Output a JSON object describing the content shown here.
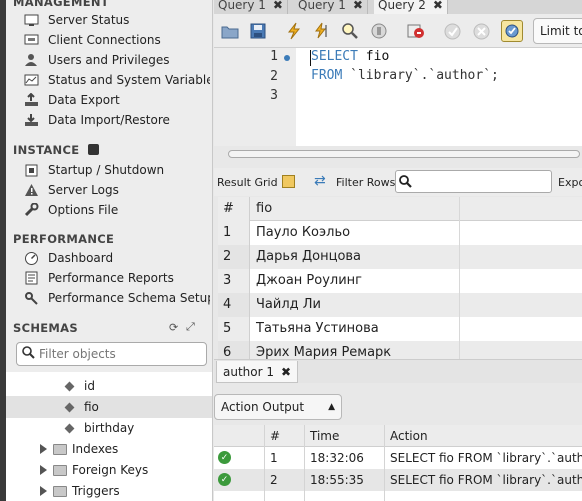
{
  "sidebar": {
    "management_title": "MANAGEMENT",
    "management_items": [
      {
        "label": "Server Status",
        "icon": "monitor-icon"
      },
      {
        "label": "Client Connections",
        "icon": "connection-icon"
      },
      {
        "label": "Users and Privileges",
        "icon": "users-icon"
      },
      {
        "label": "Status and System Variables",
        "icon": "variables-icon"
      },
      {
        "label": "Data Export",
        "icon": "export-icon"
      },
      {
        "label": "Data Import/Restore",
        "icon": "import-icon"
      }
    ],
    "instance_title": "INSTANCE",
    "instance_items": [
      {
        "label": "Startup / Shutdown",
        "icon": "power-icon"
      },
      {
        "label": "Server Logs",
        "icon": "warning-icon"
      },
      {
        "label": "Options File",
        "icon": "wrench-icon"
      }
    ],
    "performance_title": "PERFORMANCE",
    "performance_items": [
      {
        "label": "Dashboard",
        "icon": "dashboard-icon"
      },
      {
        "label": "Performance Reports",
        "icon": "reports-icon"
      },
      {
        "label": "Performance Schema Setup",
        "icon": "schema-setup-icon"
      }
    ],
    "schemas_title": "SCHEMAS",
    "schema_filter_placeholder": "Filter objects",
    "tree": {
      "columns": [
        "id",
        "fio",
        "birthday"
      ],
      "selected_column": "fio",
      "folders": [
        "Indexes",
        "Foreign Keys",
        "Triggers"
      ]
    }
  },
  "tabs": [
    {
      "label": "Query 1",
      "active": false
    },
    {
      "label": "Query 1",
      "active": false
    },
    {
      "label": "Query 2",
      "active": true
    }
  ],
  "toolbar": {
    "limit_label": "Limit to"
  },
  "editor": {
    "line_numbers": [
      "1",
      "2",
      "3"
    ],
    "line1_kw": "SELECT",
    "line1_rest": " fio",
    "line2_kw": "FROM",
    "line2_rest": " `library`.`author`;"
  },
  "result_bar": {
    "result_grid_label": "Result Grid",
    "filter_rows_label": "Filter Rows:",
    "export_label": "Export"
  },
  "grid": {
    "columns": [
      "#",
      "fio"
    ],
    "rows": [
      {
        "num": "1",
        "fio": "Пауло Коэльо"
      },
      {
        "num": "2",
        "fio": "Дарья Донцова"
      },
      {
        "num": "3",
        "fio": "Джоан Роулинг"
      },
      {
        "num": "4",
        "fio": "Чайлд Ли"
      },
      {
        "num": "5",
        "fio": "Татьяна Устинова"
      },
      {
        "num": "6",
        "fio": "Эрих Мария Ремарк"
      }
    ]
  },
  "result_tab": {
    "label": "author 1"
  },
  "output": {
    "selector_label": "Action Output",
    "columns": [
      "#",
      "Time",
      "Action"
    ],
    "rows": [
      {
        "num": "1",
        "time": "18:32:06",
        "action": "SELECT fio FROM `library`.`author`"
      },
      {
        "num": "2",
        "time": "18:55:35",
        "action": "SELECT fio FROM `library`.`author`"
      }
    ]
  },
  "colors": {
    "keyword": "#3b7bb8",
    "success": "#3c9a3c"
  }
}
